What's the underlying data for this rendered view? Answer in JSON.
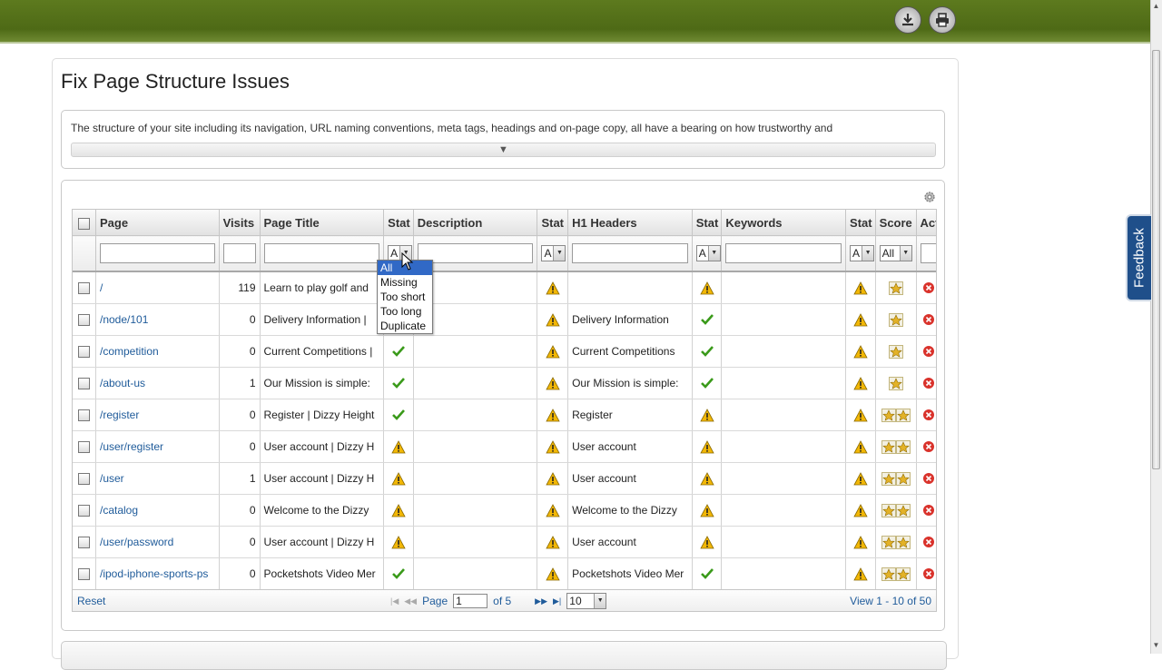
{
  "header": {
    "download_icon": "download-icon",
    "print_icon": "print-icon"
  },
  "page_title": "Fix Page Structure Issues",
  "intro": {
    "text": "The structure of your site including its navigation, URL naming conventions, meta tags, headings and on-page copy, all have a bearing on how trustworthy and",
    "expander": "▼"
  },
  "columns": {
    "page": "Page",
    "visits": "Visits",
    "page_title": "Page Title",
    "stat": "Stat",
    "description": "Description",
    "h1": "H1 Headers",
    "keywords": "Keywords",
    "score": "Score",
    "actions": "Actions"
  },
  "filters": {
    "stat_value": "A",
    "score_value": "All"
  },
  "dropdown": {
    "options": [
      "All",
      "Missing",
      "Too short",
      "Too long",
      "Duplicate"
    ],
    "selected": "All"
  },
  "rows": [
    {
      "page": "/",
      "visits": "119",
      "title": "Learn to play golf and",
      "title_status": "none",
      "desc": "",
      "desc_status": "warn",
      "h1": "",
      "h1_status": "warn",
      "kw": "",
      "kw_status": "warn",
      "score": 1
    },
    {
      "page": "/node/101",
      "visits": "0",
      "title": "Delivery Information |",
      "title_status": "none",
      "desc": "",
      "desc_status": "warn",
      "h1": "Delivery Information",
      "h1_status": "ok",
      "kw": "",
      "kw_status": "warn",
      "score": 1
    },
    {
      "page": "/competition",
      "visits": "0",
      "title": "Current Competitions |",
      "title_status": "ok",
      "desc": "",
      "desc_status": "warn",
      "h1": "Current Competitions",
      "h1_status": "ok",
      "kw": "",
      "kw_status": "warn",
      "score": 1
    },
    {
      "page": "/about-us",
      "visits": "1",
      "title": "Our Mission is simple:",
      "title_status": "ok",
      "desc": "",
      "desc_status": "warn",
      "h1": "Our Mission is simple:",
      "h1_status": "ok",
      "kw": "",
      "kw_status": "warn",
      "score": 1
    },
    {
      "page": "/register",
      "visits": "0",
      "title": "Register | Dizzy Height",
      "title_status": "ok",
      "desc": "",
      "desc_status": "warn",
      "h1": "Register",
      "h1_status": "warn",
      "kw": "",
      "kw_status": "warn",
      "score": 2
    },
    {
      "page": "/user/register",
      "visits": "0",
      "title": "User account | Dizzy H",
      "title_status": "warn",
      "desc": "",
      "desc_status": "warn",
      "h1": "User account",
      "h1_status": "warn",
      "kw": "",
      "kw_status": "warn",
      "score": 2
    },
    {
      "page": "/user",
      "visits": "1",
      "title": "User account | Dizzy H",
      "title_status": "warn",
      "desc": "",
      "desc_status": "warn",
      "h1": "User account",
      "h1_status": "warn",
      "kw": "",
      "kw_status": "warn",
      "score": 2
    },
    {
      "page": "/catalog",
      "visits": "0",
      "title": "Welcome to the Dizzy",
      "title_status": "warn",
      "desc": "",
      "desc_status": "warn",
      "h1": "Welcome to the Dizzy",
      "h1_status": "warn",
      "kw": "",
      "kw_status": "warn",
      "score": 2
    },
    {
      "page": "/user/password",
      "visits": "0",
      "title": "User account | Dizzy H",
      "title_status": "warn",
      "desc": "",
      "desc_status": "warn",
      "h1": "User account",
      "h1_status": "warn",
      "kw": "",
      "kw_status": "warn",
      "score": 2
    },
    {
      "page": "/ipod-iphone-sports-ps",
      "visits": "0",
      "title": "Pocketshots Video Mer",
      "title_status": "ok",
      "desc": "",
      "desc_status": "warn",
      "h1": "Pocketshots Video Mer",
      "h1_status": "ok",
      "kw": "",
      "kw_status": "warn",
      "score": 2
    }
  ],
  "pager": {
    "reset": "Reset",
    "page_label": "Page",
    "page_value": "1",
    "of_label": "of 5",
    "per_page": "10",
    "view": "View 1 - 10 of 50"
  },
  "feedback": "Feedback",
  "colors": {
    "topbar": "#5d7a1e",
    "link": "#1f5b9a",
    "feedback": "#1f4f8a",
    "warn": "#f2b705",
    "ok": "#3a9a1a",
    "delete": "#d9322b"
  }
}
